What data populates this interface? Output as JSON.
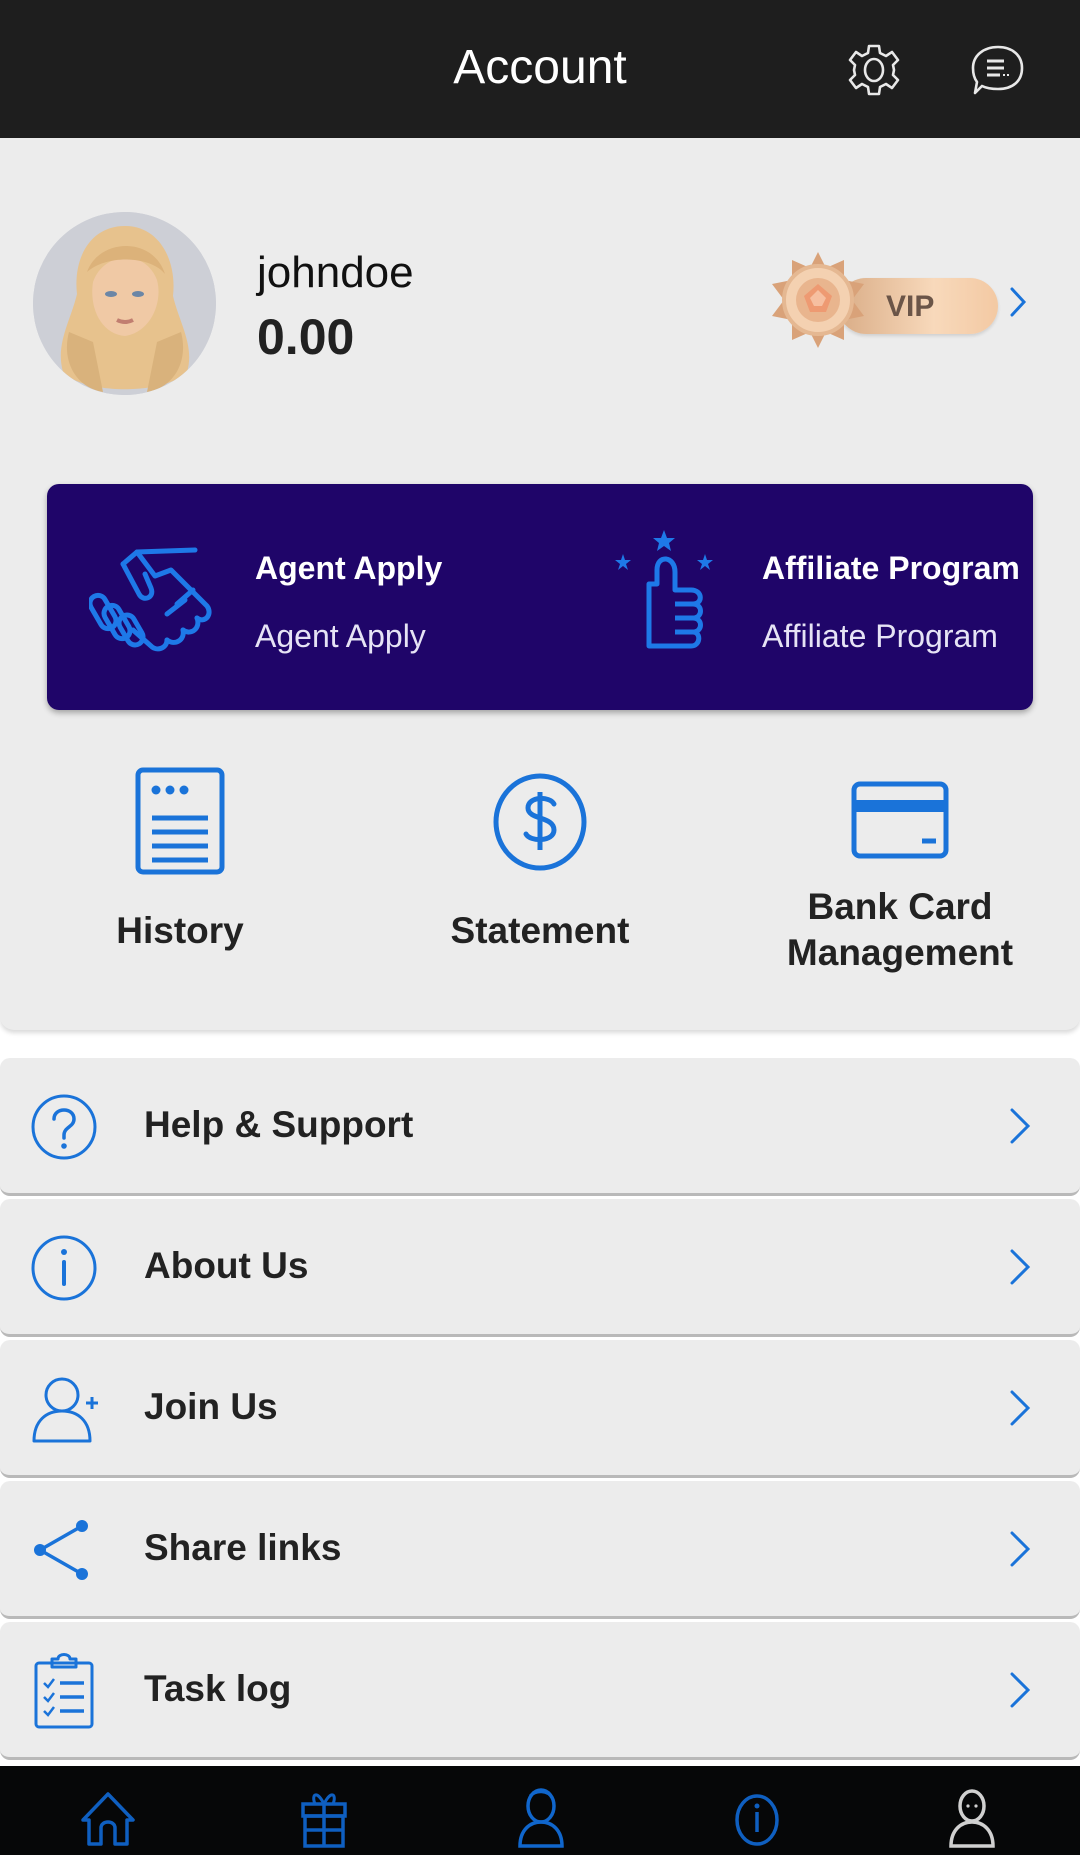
{
  "header": {
    "title": "Account",
    "settings_icon": "gear-icon",
    "messages_icon": "chat-bubble-icon"
  },
  "profile": {
    "avatar": "user-avatar-photo",
    "username": "johndoe",
    "balance": "0.00",
    "vip_label": "VIP"
  },
  "promo": {
    "agent": {
      "title": "Agent Apply",
      "subtitle": "Agent Apply",
      "icon": "handshake-icon"
    },
    "affiliate": {
      "title": "Affiliate Program",
      "subtitle": "Affiliate Program",
      "icon": "thumbs-up-icon"
    }
  },
  "shortcuts": [
    {
      "label": "History",
      "icon": "document-list-icon"
    },
    {
      "label": "Statement",
      "icon": "dollar-circle-icon"
    },
    {
      "label_line1": "Bank Card",
      "label_line2": "Management",
      "icon": "credit-card-icon"
    }
  ],
  "menu": [
    {
      "label": "Help & Support",
      "icon": "question-circle-icon"
    },
    {
      "label": "About Us",
      "icon": "info-circle-icon"
    },
    {
      "label": "Join Us",
      "icon": "user-plus-icon"
    },
    {
      "label": "Share links",
      "icon": "share-icon"
    },
    {
      "label": "Task log",
      "icon": "clipboard-check-icon"
    }
  ],
  "bottom_nav": [
    {
      "name": "home",
      "icon": "home-icon"
    },
    {
      "name": "rewards",
      "icon": "gift-icon"
    },
    {
      "name": "service",
      "icon": "agent-icon"
    },
    {
      "name": "info",
      "icon": "info-icon"
    },
    {
      "name": "account",
      "icon": "person-icon",
      "active": true
    }
  ],
  "colors": {
    "accent": "#1a73d9",
    "header_bg": "#1e1e1e",
    "promo_bg": "#1f0569",
    "card_bg": "#ececec",
    "nav_bg": "#060708"
  }
}
